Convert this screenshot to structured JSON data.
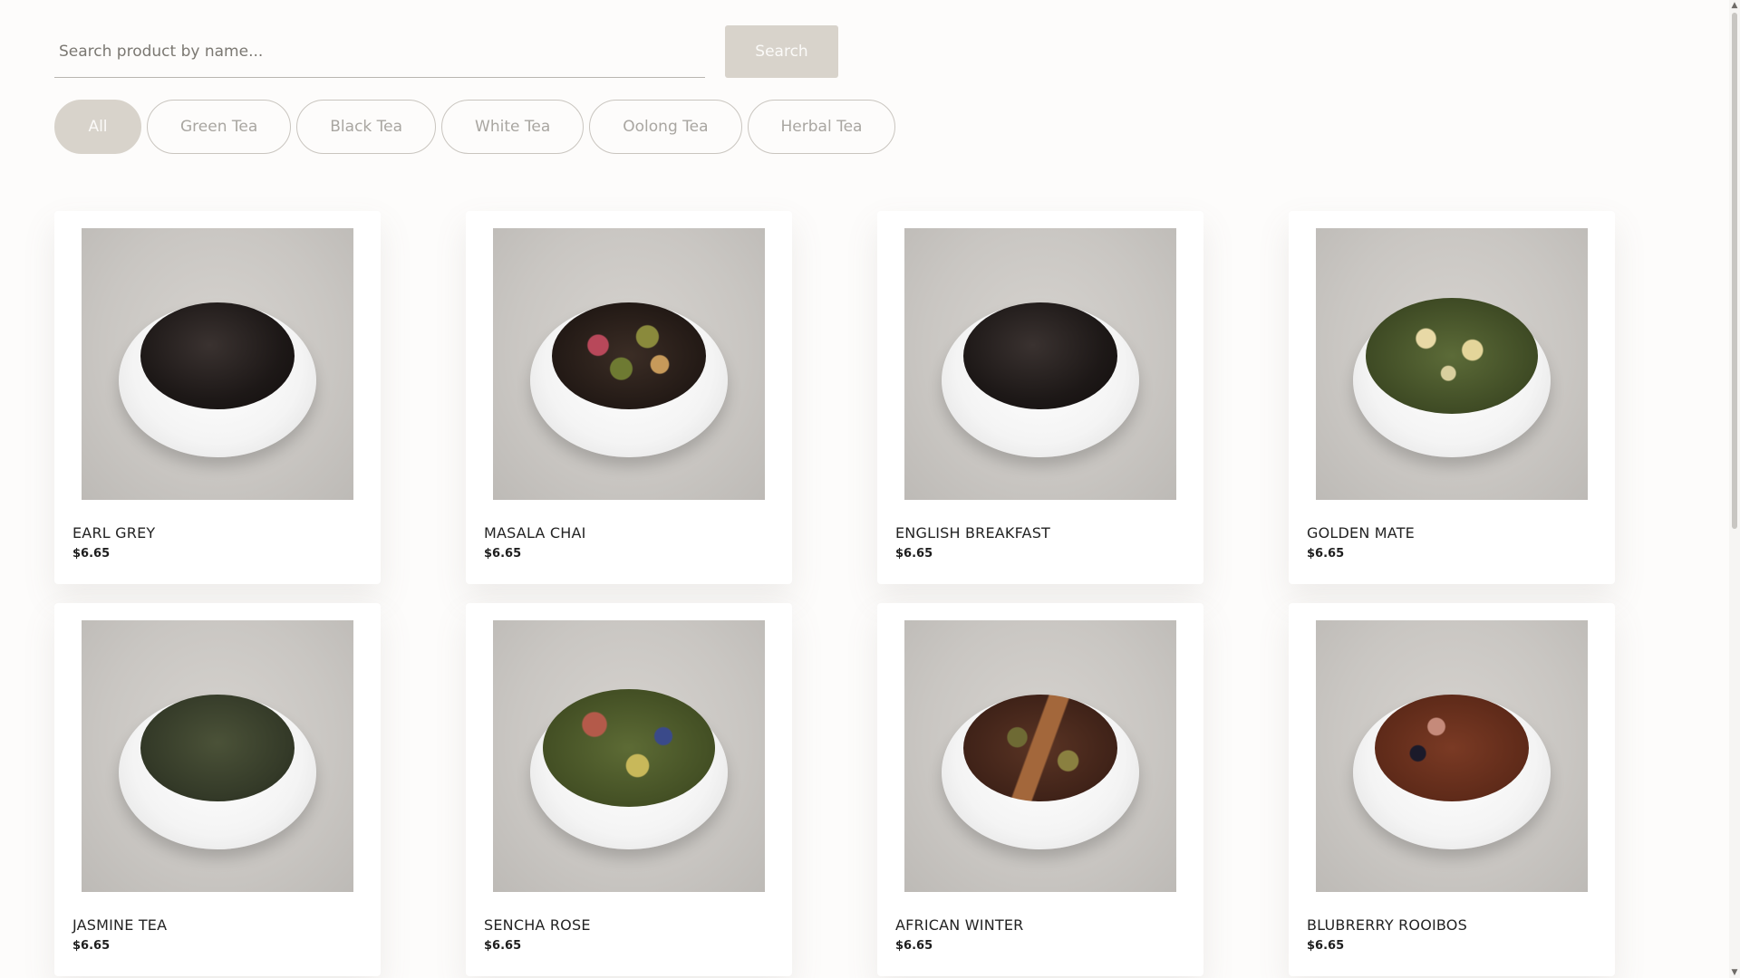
{
  "search": {
    "placeholder": "Search product by name...",
    "value": "",
    "button_label": "Search"
  },
  "filters": [
    {
      "label": "All",
      "active": true
    },
    {
      "label": "Green Tea",
      "active": false
    },
    {
      "label": "Black Tea",
      "active": false
    },
    {
      "label": "White Tea",
      "active": false
    },
    {
      "label": "Oolong Tea",
      "active": false
    },
    {
      "label": "Herbal Tea",
      "active": false
    }
  ],
  "products": [
    {
      "name": "EARL GREY",
      "price": "$6.65",
      "leaf_style": "black"
    },
    {
      "name": "MASALA CHAI",
      "price": "$6.65",
      "leaf_style": "chai"
    },
    {
      "name": "ENGLISH BREAKFAST",
      "price": "$6.65",
      "leaf_style": "black"
    },
    {
      "name": "GOLDEN MATE",
      "price": "$6.65",
      "leaf_style": "golden"
    },
    {
      "name": "JASMINE TEA",
      "price": "$6.65",
      "leaf_style": "jasmine"
    },
    {
      "name": "SENCHA ROSE",
      "price": "$6.65",
      "leaf_style": "sencha"
    },
    {
      "name": "AFRICAN WINTER",
      "price": "$6.65",
      "leaf_style": "african"
    },
    {
      "name": "BLUBRERRY ROOIBOS",
      "price": "$6.65",
      "leaf_style": "rooibos"
    }
  ],
  "colors": {
    "background": "#fdfcfb",
    "accent": "#d8d3cb",
    "pill_border": "#c9c5bf",
    "pill_text": "#a9a6a1"
  },
  "scrollbar": {
    "up_icon": "chevron-up-icon",
    "down_icon": "chevron-down-icon"
  }
}
